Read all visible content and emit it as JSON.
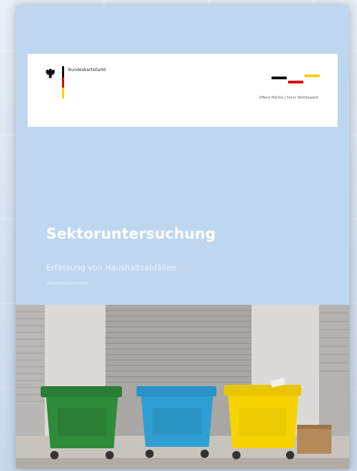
{
  "header": {
    "agency_name": "Bundeskartellamt",
    "tagline": "Offene Märkte | Fairer Wettbewerb"
  },
  "cover": {
    "title": "Sektoruntersuchung",
    "subtitle": "Erfassung von Haushaltsabfällen",
    "report_type": "Abschlussbericht"
  },
  "colors": {
    "cover_blue": "#bed7ef",
    "flag_black": "#000000",
    "flag_red": "#dd0000",
    "flag_gold": "#ffce00",
    "bin_green": "#2e8b3a",
    "bin_blue": "#2f9fd3",
    "bin_yellow": "#f5d300"
  },
  "photo": {
    "subject": "three-waste-bins-photo",
    "bins": [
      "green-bin",
      "blue-bin",
      "yellow-bin"
    ]
  }
}
